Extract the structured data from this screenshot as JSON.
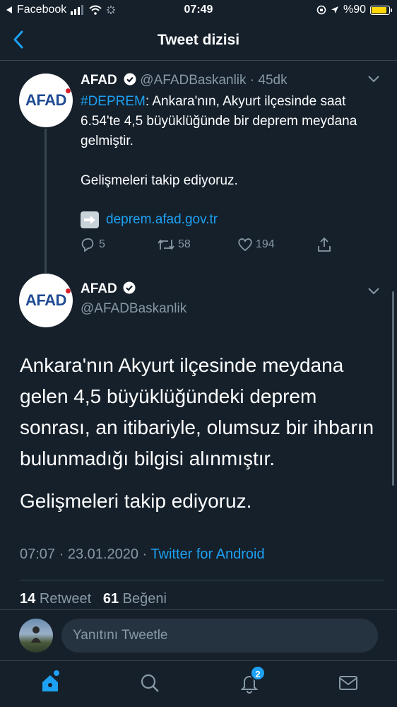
{
  "status_bar": {
    "back_app": "Facebook",
    "time": "07:49",
    "battery": "%90",
    "battery_level": 0.9
  },
  "nav": {
    "title": "Tweet dizisi"
  },
  "tweet1": {
    "avatar_text": "AFAD",
    "name": "AFAD",
    "handle": "@AFADBaskanlik",
    "separator": "·",
    "time": "45dk",
    "hashtag": "#DEPREM",
    "text_rest": ": Ankara'nın, Akyurt ilçesinde saat 6.54'te 4,5 büyüklüğünde bir deprem meydana gelmiştir.",
    "text2": "Gelişmeleri takip ediyoruz.",
    "link": "deprem.afad.gov.tr",
    "replies": "5",
    "retweets": "58",
    "likes": "194"
  },
  "tweet2": {
    "avatar_text": "AFAD",
    "name": "AFAD",
    "handle": "@AFADBaskanlik",
    "paragraph1": "Ankara'nın Akyurt ilçesinde meydana gelen 4,5 büyüklüğündeki deprem sonrası, an itibariyle, olumsuz bir ihbarın bulunmadığı bilgisi alınmıştır.",
    "paragraph2": "Gelişmeleri takip ediyoruz.",
    "time": "07:07",
    "separator1": "·",
    "date": "23.01.2020",
    "separator2": "·",
    "client": "Twitter for Android",
    "retweet_count": "14",
    "retweet_label": "Retweet",
    "like_count": "61",
    "like_label": "Beğeni"
  },
  "reply": {
    "placeholder": "Yanıtını Tweetle"
  },
  "tabbar": {
    "notification_badge": "2"
  },
  "colors": {
    "background": "#15202b",
    "accent": "#1da1f2",
    "muted": "#8899a6",
    "divider": "#38444d"
  }
}
